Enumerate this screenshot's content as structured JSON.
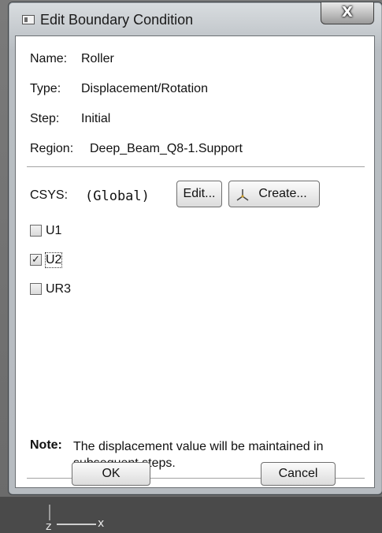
{
  "window": {
    "title": "Edit Boundary Condition",
    "close_glyph": "X"
  },
  "info": {
    "name_label": "Name:",
    "name_value": "Roller",
    "type_label": "Type:",
    "type_value": "Displacement/Rotation",
    "step_label": "Step:",
    "step_value": "Initial",
    "region_label": "Region:",
    "region_value": "Deep_Beam_Q8-1.Support"
  },
  "csys": {
    "label": "CSYS:",
    "value": "(Global)",
    "edit_label": "Edit...",
    "create_label": "Create..."
  },
  "dofs": [
    {
      "label": "U1",
      "checked": false
    },
    {
      "label": "U2",
      "checked": true
    },
    {
      "label": "UR3",
      "checked": false
    }
  ],
  "note": {
    "label": "Note:",
    "text": "The displacement value will be maintained in subsequent steps."
  },
  "buttons": {
    "ok_label": "OK",
    "cancel_label": "Cancel"
  },
  "viewport": {
    "axis_z": "z",
    "axis_x": "x"
  }
}
